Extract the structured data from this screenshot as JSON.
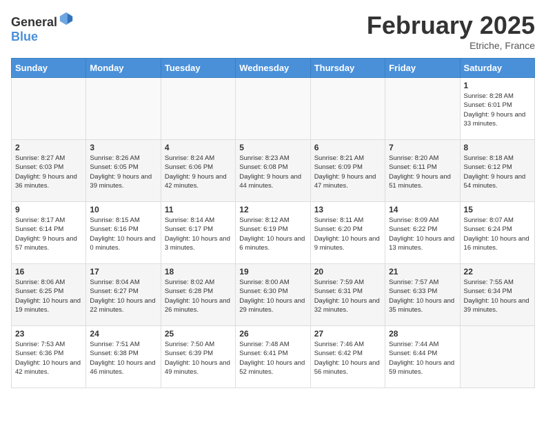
{
  "header": {
    "logo_general": "General",
    "logo_blue": "Blue",
    "month_title": "February 2025",
    "location": "Etriche, France"
  },
  "days_of_week": [
    "Sunday",
    "Monday",
    "Tuesday",
    "Wednesday",
    "Thursday",
    "Friday",
    "Saturday"
  ],
  "weeks": [
    [
      {
        "day": "",
        "info": ""
      },
      {
        "day": "",
        "info": ""
      },
      {
        "day": "",
        "info": ""
      },
      {
        "day": "",
        "info": ""
      },
      {
        "day": "",
        "info": ""
      },
      {
        "day": "",
        "info": ""
      },
      {
        "day": "1",
        "info": "Sunrise: 8:28 AM\nSunset: 6:01 PM\nDaylight: 9 hours and 33 minutes."
      }
    ],
    [
      {
        "day": "2",
        "info": "Sunrise: 8:27 AM\nSunset: 6:03 PM\nDaylight: 9 hours and 36 minutes."
      },
      {
        "day": "3",
        "info": "Sunrise: 8:26 AM\nSunset: 6:05 PM\nDaylight: 9 hours and 39 minutes."
      },
      {
        "day": "4",
        "info": "Sunrise: 8:24 AM\nSunset: 6:06 PM\nDaylight: 9 hours and 42 minutes."
      },
      {
        "day": "5",
        "info": "Sunrise: 8:23 AM\nSunset: 6:08 PM\nDaylight: 9 hours and 44 minutes."
      },
      {
        "day": "6",
        "info": "Sunrise: 8:21 AM\nSunset: 6:09 PM\nDaylight: 9 hours and 47 minutes."
      },
      {
        "day": "7",
        "info": "Sunrise: 8:20 AM\nSunset: 6:11 PM\nDaylight: 9 hours and 51 minutes."
      },
      {
        "day": "8",
        "info": "Sunrise: 8:18 AM\nSunset: 6:12 PM\nDaylight: 9 hours and 54 minutes."
      }
    ],
    [
      {
        "day": "9",
        "info": "Sunrise: 8:17 AM\nSunset: 6:14 PM\nDaylight: 9 hours and 57 minutes."
      },
      {
        "day": "10",
        "info": "Sunrise: 8:15 AM\nSunset: 6:16 PM\nDaylight: 10 hours and 0 minutes."
      },
      {
        "day": "11",
        "info": "Sunrise: 8:14 AM\nSunset: 6:17 PM\nDaylight: 10 hours and 3 minutes."
      },
      {
        "day": "12",
        "info": "Sunrise: 8:12 AM\nSunset: 6:19 PM\nDaylight: 10 hours and 6 minutes."
      },
      {
        "day": "13",
        "info": "Sunrise: 8:11 AM\nSunset: 6:20 PM\nDaylight: 10 hours and 9 minutes."
      },
      {
        "day": "14",
        "info": "Sunrise: 8:09 AM\nSunset: 6:22 PM\nDaylight: 10 hours and 13 minutes."
      },
      {
        "day": "15",
        "info": "Sunrise: 8:07 AM\nSunset: 6:24 PM\nDaylight: 10 hours and 16 minutes."
      }
    ],
    [
      {
        "day": "16",
        "info": "Sunrise: 8:06 AM\nSunset: 6:25 PM\nDaylight: 10 hours and 19 minutes."
      },
      {
        "day": "17",
        "info": "Sunrise: 8:04 AM\nSunset: 6:27 PM\nDaylight: 10 hours and 22 minutes."
      },
      {
        "day": "18",
        "info": "Sunrise: 8:02 AM\nSunset: 6:28 PM\nDaylight: 10 hours and 26 minutes."
      },
      {
        "day": "19",
        "info": "Sunrise: 8:00 AM\nSunset: 6:30 PM\nDaylight: 10 hours and 29 minutes."
      },
      {
        "day": "20",
        "info": "Sunrise: 7:59 AM\nSunset: 6:31 PM\nDaylight: 10 hours and 32 minutes."
      },
      {
        "day": "21",
        "info": "Sunrise: 7:57 AM\nSunset: 6:33 PM\nDaylight: 10 hours and 35 minutes."
      },
      {
        "day": "22",
        "info": "Sunrise: 7:55 AM\nSunset: 6:34 PM\nDaylight: 10 hours and 39 minutes."
      }
    ],
    [
      {
        "day": "23",
        "info": "Sunrise: 7:53 AM\nSunset: 6:36 PM\nDaylight: 10 hours and 42 minutes."
      },
      {
        "day": "24",
        "info": "Sunrise: 7:51 AM\nSunset: 6:38 PM\nDaylight: 10 hours and 46 minutes."
      },
      {
        "day": "25",
        "info": "Sunrise: 7:50 AM\nSunset: 6:39 PM\nDaylight: 10 hours and 49 minutes."
      },
      {
        "day": "26",
        "info": "Sunrise: 7:48 AM\nSunset: 6:41 PM\nDaylight: 10 hours and 52 minutes."
      },
      {
        "day": "27",
        "info": "Sunrise: 7:46 AM\nSunset: 6:42 PM\nDaylight: 10 hours and 56 minutes."
      },
      {
        "day": "28",
        "info": "Sunrise: 7:44 AM\nSunset: 6:44 PM\nDaylight: 10 hours and 59 minutes."
      },
      {
        "day": "",
        "info": ""
      }
    ]
  ]
}
